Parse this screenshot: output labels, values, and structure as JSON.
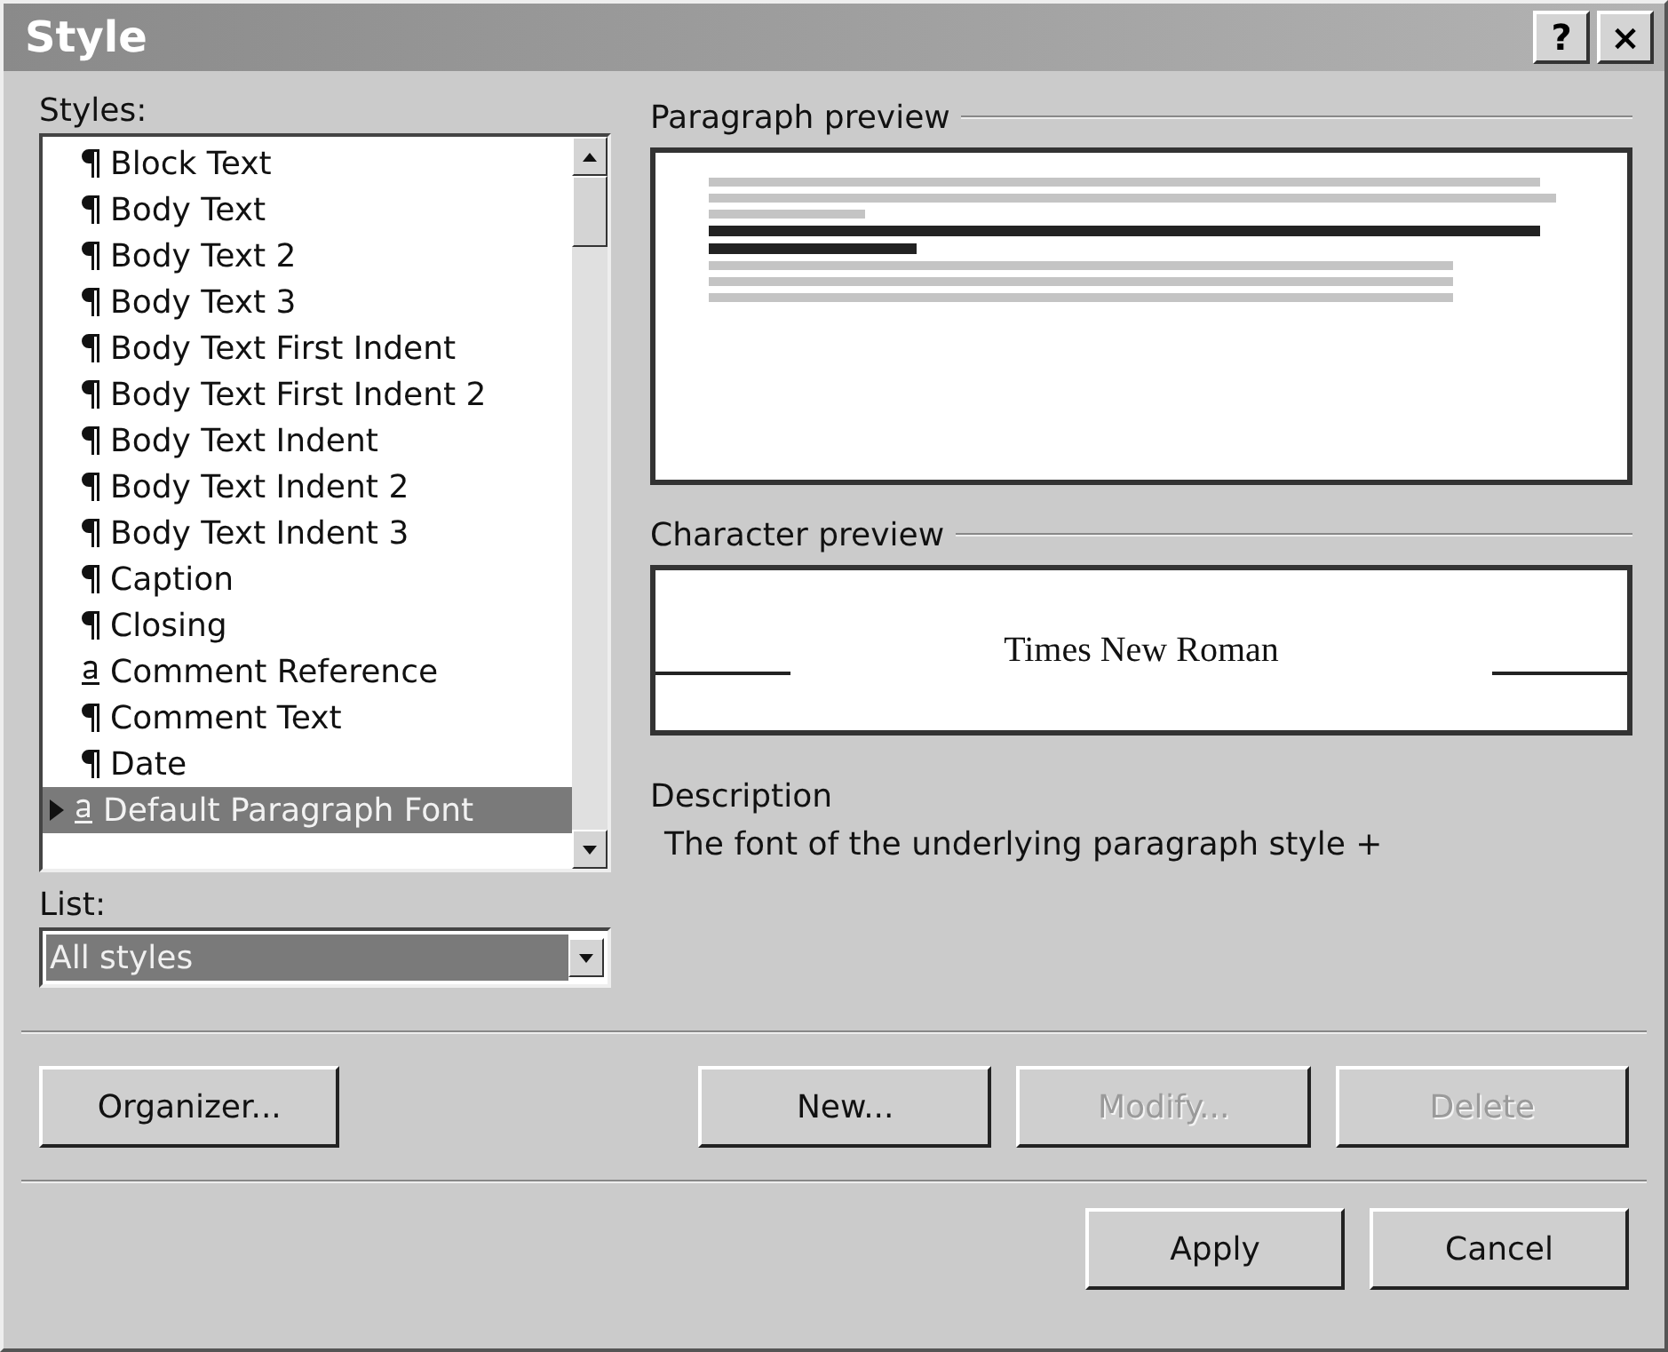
{
  "window": {
    "title": "Style",
    "help_glyph": "?",
    "close_glyph": "×"
  },
  "styles": {
    "label": "Styles:",
    "items": [
      {
        "name": "Block Text",
        "kind": "paragraph",
        "selected": false
      },
      {
        "name": "Body Text",
        "kind": "paragraph",
        "selected": false
      },
      {
        "name": "Body Text 2",
        "kind": "paragraph",
        "selected": false
      },
      {
        "name": "Body Text 3",
        "kind": "paragraph",
        "selected": false
      },
      {
        "name": "Body Text First Indent",
        "kind": "paragraph",
        "selected": false
      },
      {
        "name": "Body Text First Indent 2",
        "kind": "paragraph",
        "selected": false
      },
      {
        "name": "Body Text Indent",
        "kind": "paragraph",
        "selected": false
      },
      {
        "name": "Body Text Indent 2",
        "kind": "paragraph",
        "selected": false
      },
      {
        "name": "Body Text Indent 3",
        "kind": "paragraph",
        "selected": false
      },
      {
        "name": "Caption",
        "kind": "paragraph",
        "selected": false
      },
      {
        "name": "Closing",
        "kind": "paragraph",
        "selected": false
      },
      {
        "name": "Comment Reference",
        "kind": "character",
        "selected": false
      },
      {
        "name": "Comment Text",
        "kind": "paragraph",
        "selected": false
      },
      {
        "name": "Date",
        "kind": "paragraph",
        "selected": false
      },
      {
        "name": "Default Paragraph Font",
        "kind": "character",
        "selected": true
      }
    ]
  },
  "list": {
    "label": "List:",
    "value": "All styles"
  },
  "paragraph_preview": {
    "label": "Paragraph preview"
  },
  "character_preview": {
    "label": "Character preview",
    "sample": "Times New Roman"
  },
  "description": {
    "label": "Description",
    "text": "The font of the underlying paragraph style +"
  },
  "buttons_top": [
    {
      "label": "Organizer...",
      "disabled": false
    },
    {
      "label": "New...",
      "disabled": false
    },
    {
      "label": "Modify...",
      "disabled": true
    },
    {
      "label": "Delete",
      "disabled": true
    }
  ],
  "buttons_bottom": [
    {
      "label": "Apply",
      "disabled": false
    },
    {
      "label": "Cancel",
      "disabled": false
    }
  ]
}
